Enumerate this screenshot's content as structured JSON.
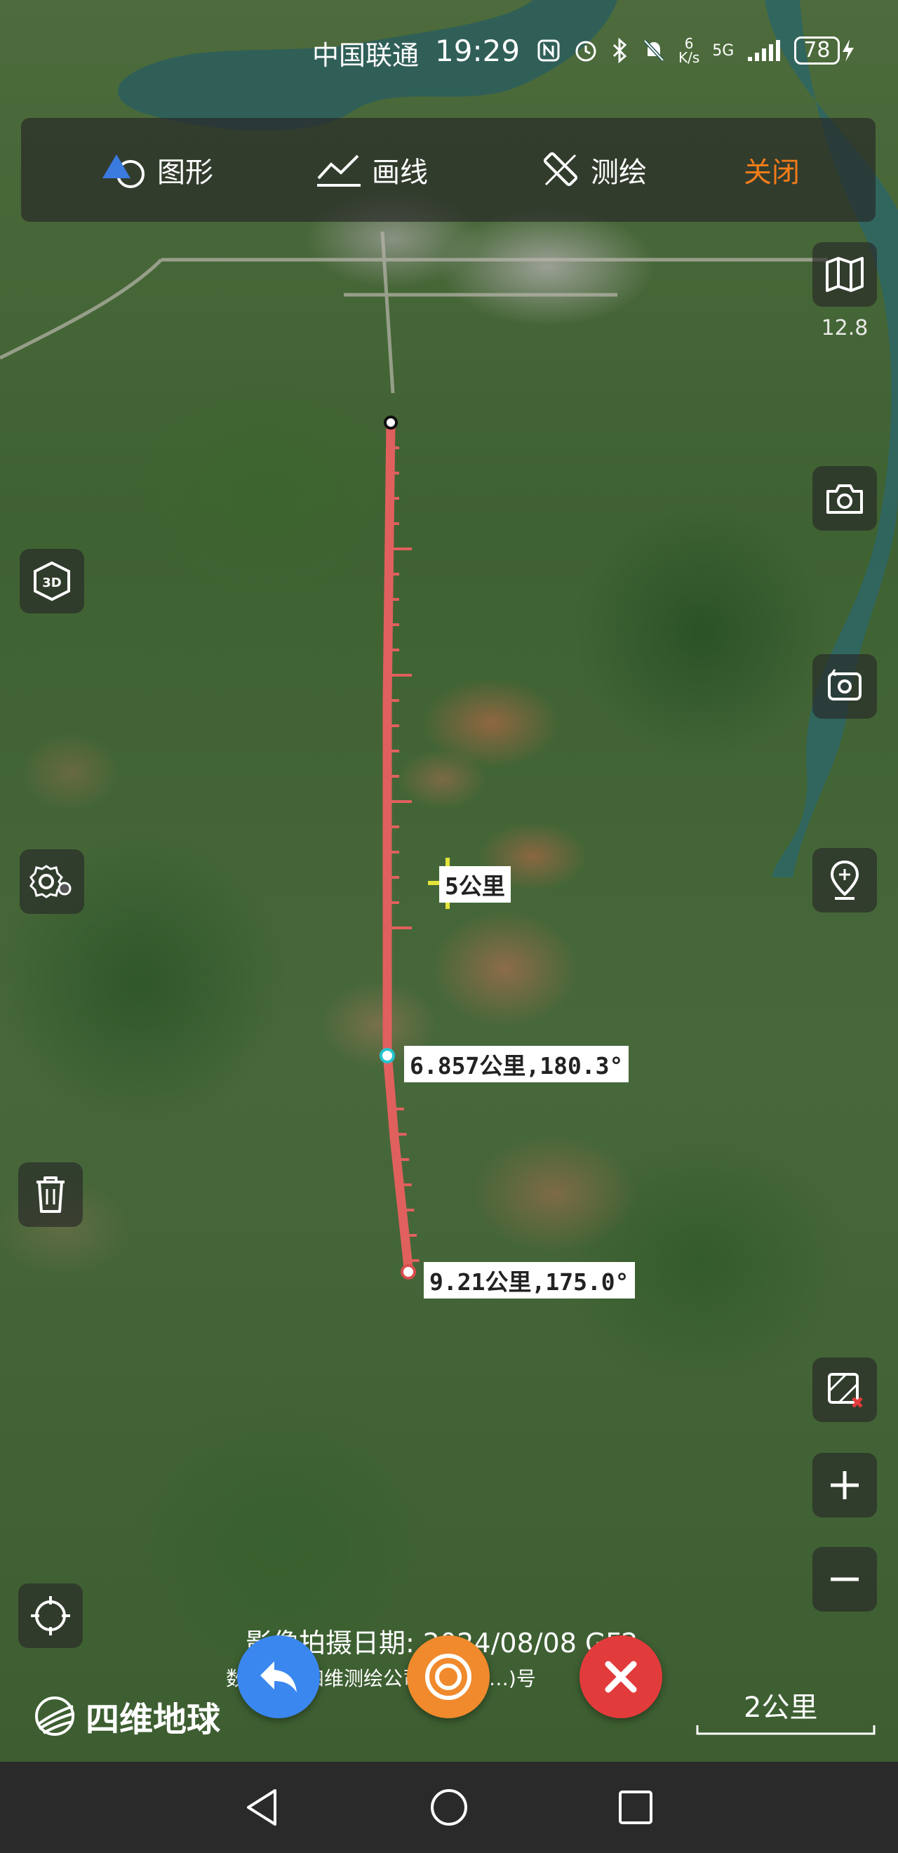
{
  "status_bar": {
    "carrier": "中国联通",
    "time": "19:29",
    "net_speed": "6\nK/s",
    "network": "5G",
    "battery": "78"
  },
  "toolbar": {
    "shape_label": "图形",
    "line_label": "画线",
    "survey_label": "测绘",
    "close_label": "关闭",
    "close_color": "#f07c1a"
  },
  "map": {
    "zoom_level": "12.8",
    "measure_color": "#e0605e",
    "cursor_label": "5公里",
    "segment_label": "6.857公里,180.3°",
    "end_label": "9.21公里,175.0°",
    "image_date": "影像拍摄日期:  2024/08/08 GF2",
    "credit": "数据：国四维测绘公司 GS(20…)号",
    "scale_label": "2公里",
    "brand": "四维地球"
  },
  "side_buttons": {
    "map_layers": "map-icon",
    "camera": "camera-icon",
    "three_d": "3d-icon",
    "rotate_view": "rotate-camera-icon",
    "settings": "settings-icon",
    "location_pin": "location-pin-icon",
    "delete": "trash-icon",
    "clear_map": "clear-map-icon",
    "zoom_in": "zoom-in-icon",
    "zoom_out": "zoom-out-icon",
    "locate": "locate-icon"
  },
  "fabs": {
    "undo_color": "#3b87f0",
    "target_color": "#f08a2c",
    "cancel_color": "#e23b3b"
  }
}
